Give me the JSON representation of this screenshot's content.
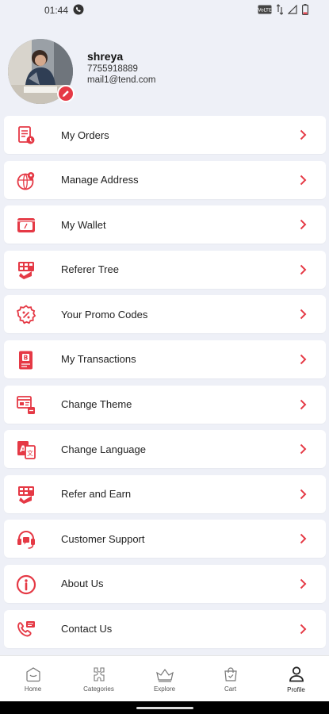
{
  "status_bar": {
    "time": "01:44",
    "whatsapp_icon": "phone-icon",
    "right_icons": [
      "volte-icon",
      "data-arrows-icon",
      "signal-icon",
      "battery-low-icon"
    ]
  },
  "profile": {
    "name": "shreya",
    "phone": "7755918889",
    "email": "mail1@tend.com"
  },
  "menu": [
    {
      "label": "My Orders",
      "icon": "orders-icon"
    },
    {
      "label": "Manage Address",
      "icon": "address-icon"
    },
    {
      "label": "My Wallet",
      "icon": "wallet-icon"
    },
    {
      "label": "Referer Tree",
      "icon": "referer-tree-icon"
    },
    {
      "label": "Your Promo Codes",
      "icon": "promo-code-icon"
    },
    {
      "label": "My Transactions",
      "icon": "transactions-icon"
    },
    {
      "label": "Change Theme",
      "icon": "theme-icon"
    },
    {
      "label": "Change Language",
      "icon": "language-icon"
    },
    {
      "label": "Refer and Earn",
      "icon": "refer-earn-icon"
    },
    {
      "label": "Customer Support",
      "icon": "support-icon"
    },
    {
      "label": "About Us",
      "icon": "info-icon"
    },
    {
      "label": "Contact Us",
      "icon": "contact-icon"
    }
  ],
  "bottom_nav": [
    {
      "label": "Home",
      "icon": "home-icon"
    },
    {
      "label": "Categories",
      "icon": "categories-icon"
    },
    {
      "label": "Explore",
      "icon": "explore-icon"
    },
    {
      "label": "Cart",
      "icon": "cart-icon"
    },
    {
      "label": "Profile",
      "icon": "profile-icon",
      "active": true
    }
  ],
  "colors": {
    "accent": "#e53945",
    "background": "#eef0f7",
    "card": "#ffffff"
  }
}
